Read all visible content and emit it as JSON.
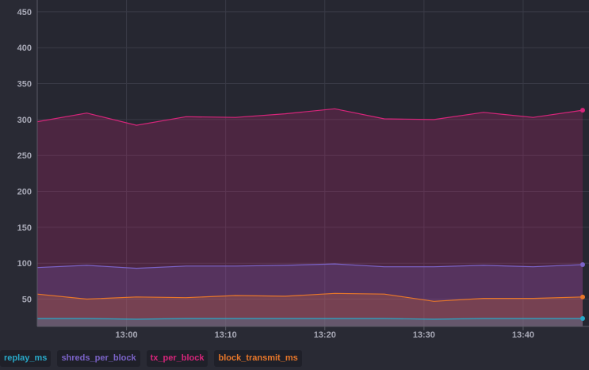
{
  "chart_data": {
    "type": "area",
    "x_ticks": [
      "13:00",
      "13:10",
      "13:20",
      "13:30",
      "13:40"
    ],
    "y_ticks": [
      50,
      100,
      150,
      200,
      250,
      300,
      350,
      400,
      450
    ],
    "ylim": [
      12,
      462
    ],
    "x": [
      "12:51",
      "12:56",
      "13:01",
      "13:06",
      "13:11",
      "13:16",
      "13:21",
      "13:26",
      "13:31",
      "13:36",
      "13:41",
      "13:46"
    ],
    "grid": true,
    "series": [
      {
        "name": "replay_ms",
        "color": "#29a8c8",
        "values": [
          23,
          23,
          22,
          23,
          23,
          23,
          23,
          23,
          22,
          23,
          23,
          23
        ]
      },
      {
        "name": "shreds_per_block",
        "color": "#7b63c8",
        "values": [
          94,
          97,
          93,
          96,
          96,
          97,
          99,
          95,
          95,
          97,
          95,
          98
        ]
      },
      {
        "name": "tx_per_block",
        "color": "#d6257a",
        "values": [
          297,
          309,
          292,
          304,
          303,
          308,
          315,
          301,
          300,
          310,
          303,
          313
        ]
      },
      {
        "name": "block_transmit_ms",
        "color": "#e8772a",
        "values": [
          57,
          50,
          53,
          52,
          55,
          54,
          58,
          57,
          47,
          51,
          51,
          53
        ]
      }
    ]
  }
}
